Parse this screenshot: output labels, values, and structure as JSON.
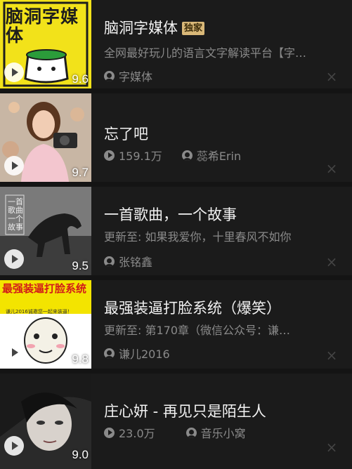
{
  "items": [
    {
      "title": "脑洞字媒体",
      "badge": "独家",
      "subtitle": "全网最好玩儿的语言文字解读平台【字…",
      "author": "字媒体",
      "score": "9.6",
      "cover_text": "脑洞字媒体"
    },
    {
      "title": "忘了吧",
      "plays": "159.1万",
      "author": "蕊希Erin",
      "score": "9.7"
    },
    {
      "title": "一首歌曲，一个故事",
      "subtitle": "更新至: 如果我爱你，十里春风不如你",
      "author": "张铭鑫",
      "score": "9.5",
      "cover_text": "一首歌曲一个故事"
    },
    {
      "title": "最强装逼打脸系统（爆笑）",
      "subtitle": "更新至: 第170章（微信公众号：谦…",
      "author": "谦儿2016",
      "score": "9.8",
      "cover_text": "最强装逼打脸系统",
      "cover_sub": "谦儿2016诚邀您一起来装逼！"
    },
    {
      "title": "庄心妍 - 再见只是陌生人",
      "plays": "23.0万",
      "author": "音乐小窝",
      "score": "9.0"
    }
  ]
}
